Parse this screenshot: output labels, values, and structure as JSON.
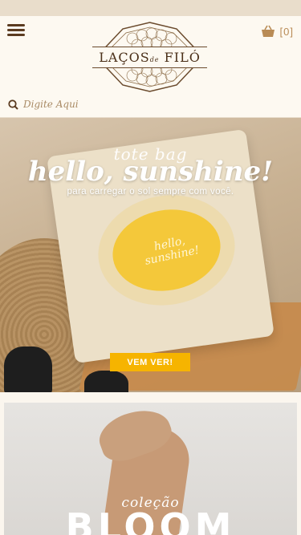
{
  "header": {
    "cart_count": "[0]",
    "logo": {
      "word": "LAÇOS",
      "connector": "de",
      "word2": "FILÓ"
    }
  },
  "search": {
    "placeholder": "Digite Aqui"
  },
  "hero": {
    "kicker": "tote bag",
    "headline": "hello, sunshine!",
    "subtitle": "para carregar o sol sempre com você.",
    "bag_print": "hello, sunshine!",
    "cta": "VEM VER!"
  },
  "banner2": {
    "kicker": "coleção",
    "title": "BLOOM"
  },
  "colors": {
    "accent": "#f6b400",
    "brand_brown": "#5b3b20",
    "cart_tan": "#b98b55",
    "background": "#fbf6ee"
  },
  "icons": [
    "menu-icon",
    "cart-basket-icon",
    "search-icon"
  ]
}
